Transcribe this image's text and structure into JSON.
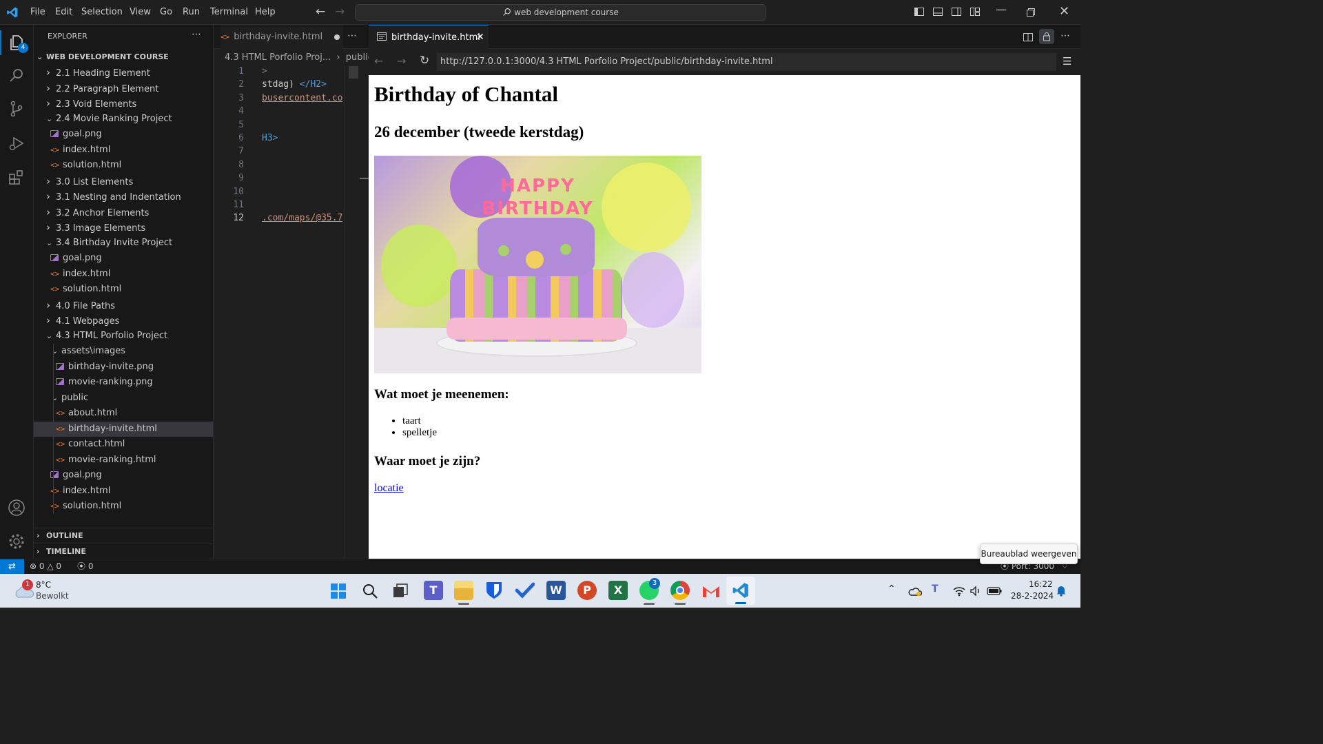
{
  "titlebar": {
    "menu": [
      "File",
      "Edit",
      "Selection",
      "View",
      "Go",
      "Run",
      "Terminal",
      "Help"
    ],
    "search": "web development course"
  },
  "activitybar": {
    "explorer_badge": "4"
  },
  "sidebar": {
    "header": "EXPLORER",
    "root": "WEB DEVELOPMENT COURSE",
    "items": [
      {
        "label": "2.1 Heading Element",
        "kind": "folder-closed",
        "depth": 1
      },
      {
        "label": "2.2 Paragraph Element",
        "kind": "folder-closed",
        "depth": 1
      },
      {
        "label": "2.3 Void Elements",
        "kind": "folder-closed",
        "depth": 1
      },
      {
        "label": "2.4 Movie Ranking Project",
        "kind": "folder-open",
        "depth": 1
      },
      {
        "label": "goal.png",
        "kind": "png",
        "depth": 2
      },
      {
        "label": "index.html",
        "kind": "html",
        "depth": 2
      },
      {
        "label": "solution.html",
        "kind": "html",
        "depth": 2
      },
      {
        "label": "3.0 List Elements",
        "kind": "folder-closed",
        "depth": 1
      },
      {
        "label": "3.1 Nesting and Indentation",
        "kind": "folder-closed",
        "depth": 1
      },
      {
        "label": "3.2 Anchor Elements",
        "kind": "folder-closed",
        "depth": 1
      },
      {
        "label": "3.3 Image Elements",
        "kind": "folder-closed",
        "depth": 1
      },
      {
        "label": "3.4 Birthday Invite Project",
        "kind": "folder-open",
        "depth": 1
      },
      {
        "label": "goal.png",
        "kind": "png",
        "depth": 2
      },
      {
        "label": "index.html",
        "kind": "html",
        "depth": 2
      },
      {
        "label": "solution.html",
        "kind": "html",
        "depth": 2
      },
      {
        "label": "4.0 File Paths",
        "kind": "folder-closed",
        "depth": 1
      },
      {
        "label": "4.1 Webpages",
        "kind": "folder-closed",
        "depth": 1
      },
      {
        "label": "4.3 HTML Porfolio Project",
        "kind": "folder-open",
        "depth": 1
      },
      {
        "label": "assets\\images",
        "kind": "folder-open",
        "depth": 2
      },
      {
        "label": "birthday-invite.png",
        "kind": "png",
        "depth": 3
      },
      {
        "label": "movie-ranking.png",
        "kind": "png",
        "depth": 3
      },
      {
        "label": "public",
        "kind": "folder-open",
        "depth": 2
      },
      {
        "label": "about.html",
        "kind": "html",
        "depth": 3
      },
      {
        "label": "birthday-invite.html",
        "kind": "html",
        "depth": 3,
        "selected": true
      },
      {
        "label": "contact.html",
        "kind": "html",
        "depth": 3
      },
      {
        "label": "movie-ranking.html",
        "kind": "html",
        "depth": 3
      },
      {
        "label": "goal.png",
        "kind": "png",
        "depth": 2
      },
      {
        "label": "index.html",
        "kind": "html",
        "depth": 2
      },
      {
        "label": "solution.html",
        "kind": "html",
        "depth": 2
      }
    ],
    "outline": "OUTLINE",
    "timeline": "TIMELINE"
  },
  "editor": {
    "tab": "birthday-invite.html",
    "breadcrumb_1": "4.3 HTML Porfolio Proj...",
    "breadcrumb_2": "public",
    "lines": [
      {
        "n": "1",
        "text": ">",
        "color": "#808080"
      },
      {
        "n": "2",
        "text": "stdag) ",
        "tag": "</H2>",
        "color": "#cccccc"
      },
      {
        "n": "3",
        "text": "busercontent.co",
        "color": "#ce9178",
        "underline": true
      },
      {
        "n": "4",
        "text": ""
      },
      {
        "n": "5",
        "text": ""
      },
      {
        "n": "6",
        "text": "",
        "tag": "H3>"
      },
      {
        "n": "7",
        "text": ""
      },
      {
        "n": "8",
        "text": ""
      },
      {
        "n": "9",
        "text": ""
      },
      {
        "n": "10",
        "text": ""
      },
      {
        "n": "11",
        "text": ""
      },
      {
        "n": "12",
        "text": ".com/maps/@35.7",
        "color": "#ce9178",
        "underline": true
      }
    ]
  },
  "browser": {
    "tab": "birthday-invite.html",
    "url": "http://127.0.0.1:3000/4.3 HTML Porfolio Project/public/birthday-invite.html",
    "page": {
      "h1": "Birthday of Chantal",
      "h2": "26 december (tweede kerstdag)",
      "h3_bring": "Wat moet je meenemen:",
      "list": [
        "taart",
        "spelletje"
      ],
      "h3_where": "Waar moet je zijn?",
      "link": "locatie",
      "cake_text": "HAPPY BIRTHDAY"
    }
  },
  "statusbar": {
    "errors": "0",
    "warnings": "0",
    "ports": "0",
    "port_right": "Port: 3000"
  },
  "tooltip": "Bureaublad weergeven",
  "taskbar": {
    "weather_temp": "8°C",
    "weather_desc": "Bewolkt",
    "weather_badge": "1",
    "whatsapp_badge": "3",
    "time": "16:22",
    "date": "28-2-2024"
  }
}
